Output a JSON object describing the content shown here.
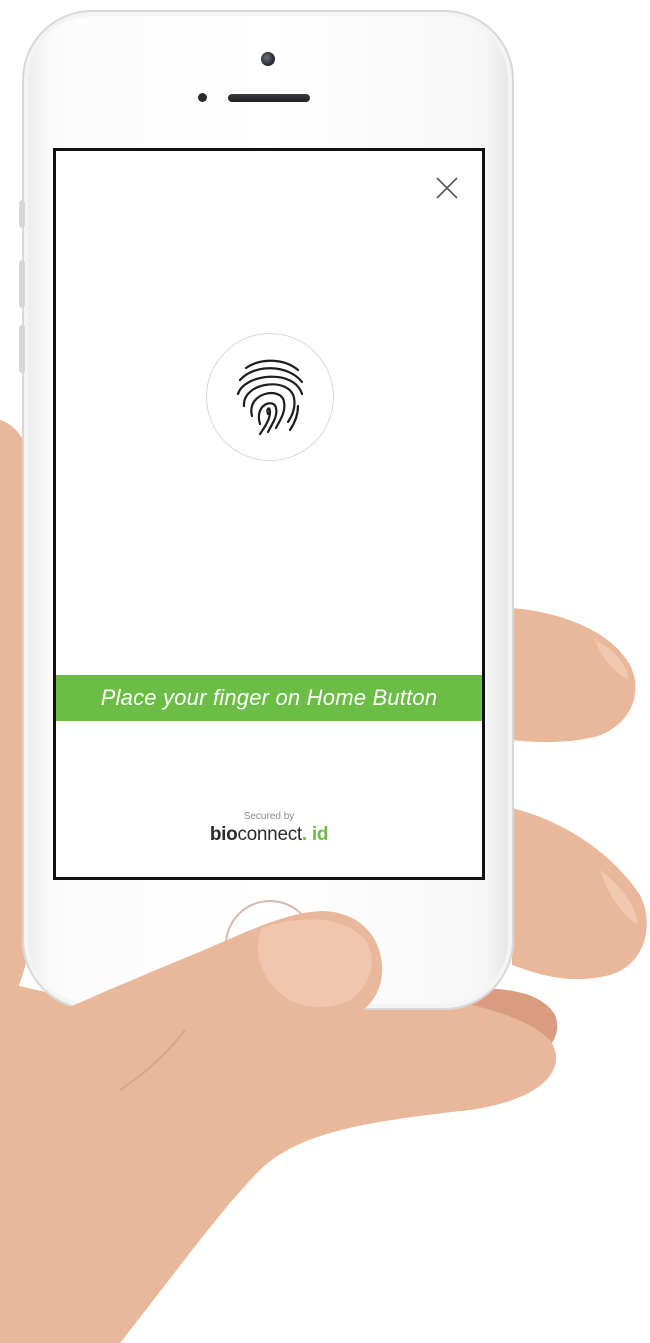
{
  "screen": {
    "close_icon": "close-icon",
    "fingerprint_icon": "fingerprint-icon",
    "prompt": "Place your finger on Home Button",
    "secured_label": "Secured by",
    "brand": {
      "bold": "bio",
      "regular": "connect",
      "dot": ".",
      "suffix": " id"
    }
  },
  "colors": {
    "accent": "#6bbd45",
    "screen_border": "#111111",
    "text_dark": "#2b2b2b"
  }
}
